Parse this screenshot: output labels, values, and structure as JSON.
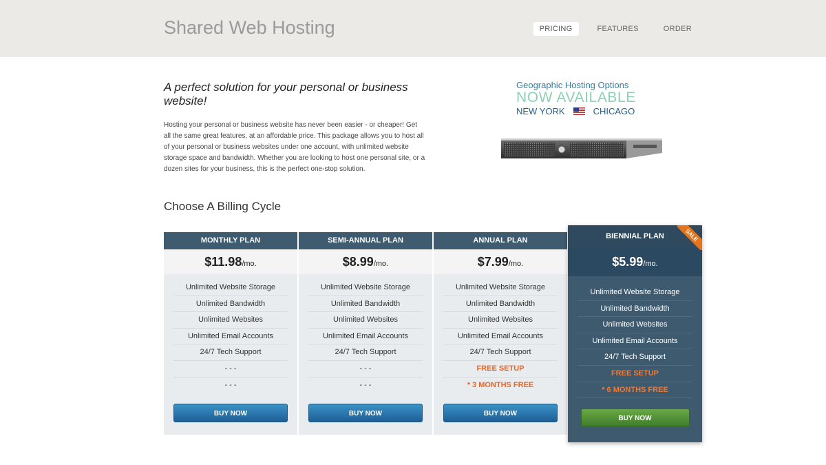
{
  "header": {
    "site_title": "Shared Web Hosting",
    "nav": [
      {
        "label": "PRICING",
        "active": true
      },
      {
        "label": "FEATURES",
        "active": false
      },
      {
        "label": "ORDER",
        "active": false
      }
    ]
  },
  "intro": {
    "heading": "A perfect solution for your personal or business website!",
    "text": "Hosting your personal or business website has never been easier - or cheaper! Get all the same great features, at an affordable price. This package allows you to host all of your personal or business websites under one account, with unlimited website storage space and bandwidth. Whether you are looking to host one personal site, or a dozen sites for your business, this is the perfect one-stop solution."
  },
  "promo": {
    "line1": "Geographic Hosting Options",
    "line2": "NOW AVAILABLE",
    "location1": "NEW YORK",
    "location2": "CHICAGO"
  },
  "billing": {
    "title": "Choose A Billing Cycle",
    "plans": [
      {
        "name": "MONTHLY PLAN",
        "price": "$11.98",
        "per": "/mo.",
        "features": [
          "Unlimited Website Storage",
          "Unlimited Bandwidth",
          "Unlimited Websites",
          "Unlimited Email Accounts",
          "24/7 Tech Support",
          "- - -",
          "- - -"
        ],
        "button": "BUY NOW"
      },
      {
        "name": "SEMI-ANNUAL PLAN",
        "price": "$8.99",
        "per": "/mo.",
        "features": [
          "Unlimited Website Storage",
          "Unlimited Bandwidth",
          "Unlimited Websites",
          "Unlimited Email Accounts",
          "24/7 Tech Support",
          "- - -",
          "- - -"
        ],
        "button": "BUY NOW"
      },
      {
        "name": "ANNUAL PLAN",
        "price": "$7.99",
        "per": "/mo.",
        "features": [
          "Unlimited Website Storage",
          "Unlimited Bandwidth",
          "Unlimited Websites",
          "Unlimited Email Accounts",
          "24/7 Tech Support",
          "FREE SETUP",
          "* 3 MONTHS FREE"
        ],
        "button": "BUY NOW"
      },
      {
        "name": "BIENNIAL PLAN",
        "price": "$5.99",
        "per": "/mo.",
        "badge": "SALE",
        "features": [
          "Unlimited Website Storage",
          "Unlimited Bandwidth",
          "Unlimited Websites",
          "Unlimited Email Accounts",
          "24/7 Tech Support",
          "FREE SETUP",
          "* 6 MONTHS FREE"
        ],
        "button": "BUY NOW"
      }
    ]
  },
  "colors": {
    "header_bg": "#ebeae6",
    "plan_header": "#3e5b70",
    "accent_orange": "#e2672b",
    "buy_blue": "#2a7ab0",
    "buy_green": "#5a9a3a"
  }
}
